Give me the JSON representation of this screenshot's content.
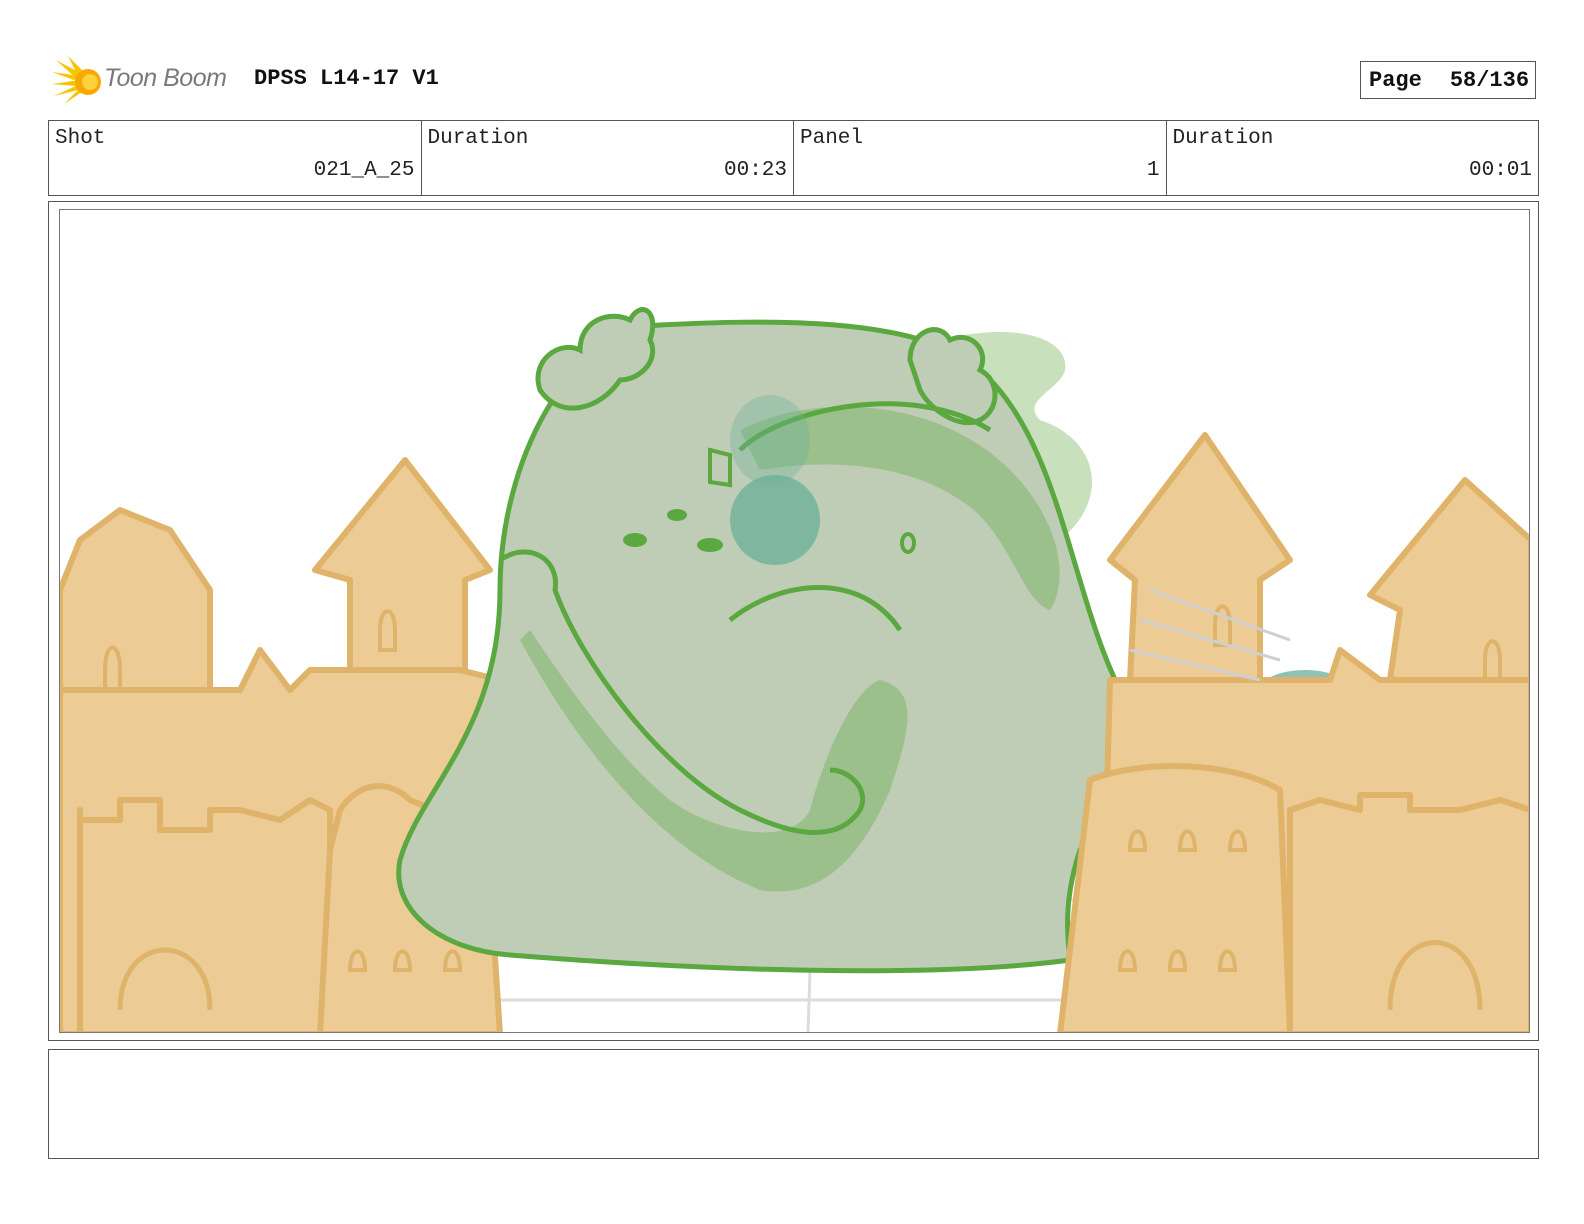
{
  "header": {
    "logo_text": "Toon Boom",
    "title": "DPSS L14-17 V1",
    "page_label": "Page",
    "page_value": "58/136"
  },
  "info": {
    "shot_label": "Shot",
    "shot_value": "021_A_25",
    "duration1_label": "Duration",
    "duration1_value": "00:23",
    "panel_label": "Panel",
    "panel_value": "1",
    "duration2_label": "Duration",
    "duration2_value": "00:01"
  },
  "colors": {
    "sand_fill": "#eccb95",
    "sand_line": "#dfb36a",
    "blob_fill": "#bfcdb6",
    "blob_line": "#5aa83f",
    "blob_shade": "#93bd82",
    "teal_spot": "#6aae98"
  }
}
